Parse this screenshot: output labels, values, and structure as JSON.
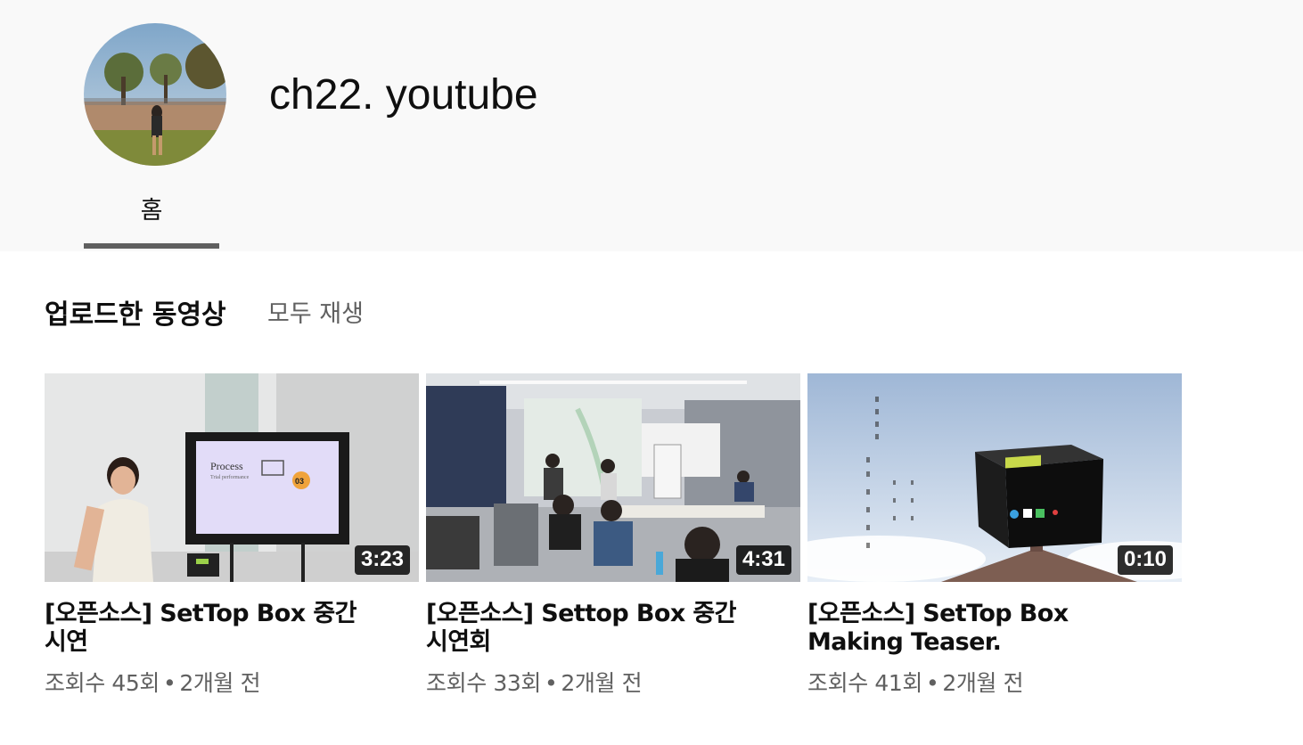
{
  "channel": {
    "name": "ch22. youtube",
    "tabs": [
      {
        "label": "홈",
        "active": true
      }
    ]
  },
  "shelf": {
    "title": "업로드한 동영상",
    "play_all_label": "모두 재생"
  },
  "videos": [
    {
      "title": "[오픈소스] SetTop Box 중간 시연",
      "duration": "3:23",
      "views": "조회수 45회",
      "age": "2개월 전",
      "slide_title": "Process",
      "slide_subtitle": "Trial performance",
      "slide_badge": "03"
    },
    {
      "title": "[오픈소스] Settop Box 중간 시연회",
      "duration": "4:31",
      "views": "조회수 33회",
      "age": "2개월 전"
    },
    {
      "title": "[오픈소스] SetTop Box Making Teaser.",
      "duration": "0:10",
      "views": "조회수 41회",
      "age": "2개월 전"
    }
  ],
  "separator": "•",
  "colors": {
    "header_bg": "#f9f9f9",
    "tab_underline": "#606060",
    "secondary_text": "#606060",
    "primary_text": "#0f0f0f"
  }
}
